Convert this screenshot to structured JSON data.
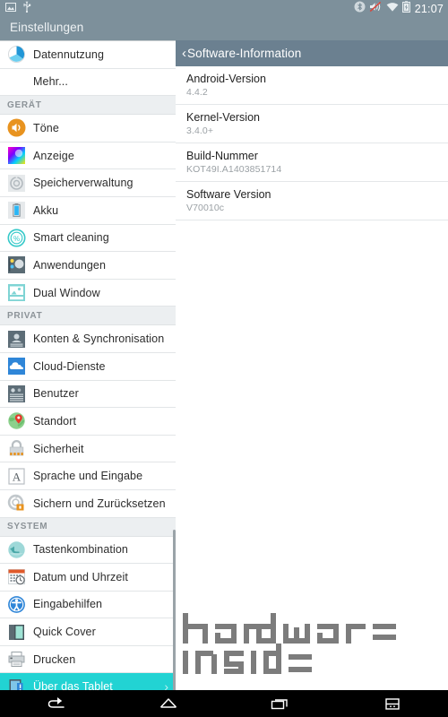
{
  "statusbar": {
    "left_icons": [
      "screenshot-icon",
      "usb-icon"
    ],
    "right_icons": [
      "bluetooth-off-icon",
      "volume-mute-icon",
      "wifi-icon",
      "battery-charging-icon"
    ],
    "clock": "21:07"
  },
  "app": {
    "title": "Einstellungen"
  },
  "sidebar": {
    "items": [
      {
        "type": "item",
        "label": "Datennutzung",
        "icon": "data-usage-icon",
        "selected": false
      },
      {
        "type": "item",
        "label": "Mehr...",
        "icon": "none",
        "selected": false
      },
      {
        "type": "header",
        "label": "GERÄT"
      },
      {
        "type": "item",
        "label": "Töne",
        "icon": "sound-icon",
        "selected": false
      },
      {
        "type": "item",
        "label": "Anzeige",
        "icon": "display-icon",
        "selected": false
      },
      {
        "type": "item",
        "label": "Speicherverwaltung",
        "icon": "storage-icon",
        "selected": false
      },
      {
        "type": "item",
        "label": "Akku",
        "icon": "battery-icon",
        "selected": false
      },
      {
        "type": "item",
        "label": "Smart cleaning",
        "icon": "smart-cleaning-icon",
        "selected": false
      },
      {
        "type": "item",
        "label": "Anwendungen",
        "icon": "apps-icon",
        "selected": false
      },
      {
        "type": "item",
        "label": "Dual Window",
        "icon": "dual-window-icon",
        "selected": false
      },
      {
        "type": "header",
        "label": "PRIVAT"
      },
      {
        "type": "item",
        "label": "Konten & Synchronisation",
        "icon": "accounts-icon",
        "selected": false
      },
      {
        "type": "item",
        "label": "Cloud-Dienste",
        "icon": "cloud-icon",
        "selected": false
      },
      {
        "type": "item",
        "label": "Benutzer",
        "icon": "users-icon",
        "selected": false
      },
      {
        "type": "item",
        "label": "Standort",
        "icon": "location-icon",
        "selected": false
      },
      {
        "type": "item",
        "label": "Sicherheit",
        "icon": "lock-icon",
        "selected": false
      },
      {
        "type": "item",
        "label": "Sprache und Eingabe",
        "icon": "language-icon",
        "selected": false
      },
      {
        "type": "item",
        "label": "Sichern und Zurücksetzen",
        "icon": "backup-reset-icon",
        "selected": false
      },
      {
        "type": "header",
        "label": "SYSTEM"
      },
      {
        "type": "item",
        "label": "Tastenkombination",
        "icon": "shortcut-key-icon",
        "selected": false
      },
      {
        "type": "item",
        "label": "Datum und Uhrzeit",
        "icon": "date-time-icon",
        "selected": false
      },
      {
        "type": "item",
        "label": "Eingabehilfen",
        "icon": "accessibility-icon",
        "selected": false
      },
      {
        "type": "item",
        "label": "Quick Cover",
        "icon": "quick-cover-icon",
        "selected": false
      },
      {
        "type": "item",
        "label": "Drucken",
        "icon": "printer-icon",
        "selected": false
      },
      {
        "type": "item",
        "label": "Über das Tablet",
        "icon": "about-tablet-icon",
        "selected": true,
        "chevron": "›"
      }
    ]
  },
  "content": {
    "back_chevron": "‹",
    "title": "Software-Information",
    "rows": [
      {
        "title": "Android-Version",
        "value": "4.4.2"
      },
      {
        "title": "Kernel-Version",
        "value": "3.4.0+"
      },
      {
        "title": "Build-Nummer",
        "value": "KOT49I.A1403851714"
      },
      {
        "title": "Software Version",
        "value": "V70010c"
      }
    ]
  },
  "watermark": {
    "line1": "hardware",
    "line2": "inside"
  },
  "navbar": {
    "buttons": [
      "back-nav-icon",
      "home-nav-icon",
      "recents-nav-icon",
      "dual-window-nav-icon"
    ]
  },
  "colors": {
    "status_bar": "#7d909b",
    "content_header": "#6b8090",
    "selected_row": "#22d3d3",
    "section_header_bg": "#eceff1",
    "navbar": "#000000"
  }
}
